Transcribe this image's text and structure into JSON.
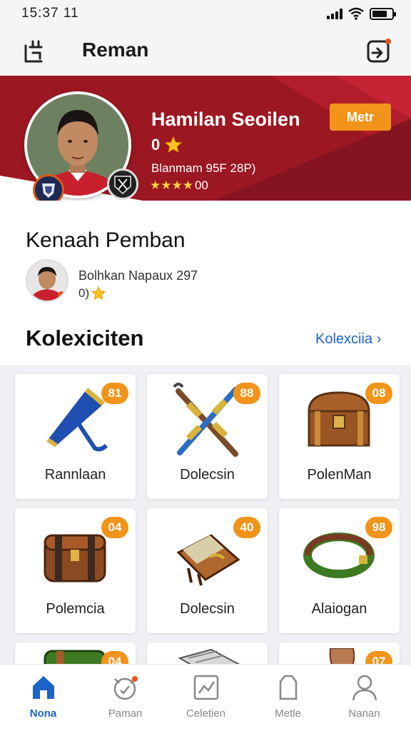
{
  "status_bar": {
    "time": "15:37 11"
  },
  "header": {
    "title": "Reman"
  },
  "profile": {
    "name": "Hamilan Seoilen",
    "level": "0",
    "meta": "Blanmam 95F 28P)",
    "rating_stars": "★★★★",
    "rating_value": "00",
    "more_label": "Metr"
  },
  "recommend": {
    "title": "Kenaah Pemban",
    "name": "Bolhkan Napaux 297",
    "level": "0)"
  },
  "collection": {
    "title": "Kolexiciten",
    "link": "Kolexciia ›",
    "items": [
      {
        "label": "Rannlaan",
        "count": "81"
      },
      {
        "label": "Dolecsin",
        "count": "88"
      },
      {
        "label": "PolenMan",
        "count": "08"
      },
      {
        "label": "Polemcia",
        "count": "04"
      },
      {
        "label": "Dolecsin",
        "count": "40"
      },
      {
        "label": "Alaiogan",
        "count": "98"
      },
      {
        "label": "",
        "count": "04"
      },
      {
        "label": "",
        "count": ""
      },
      {
        "label": "",
        "count": "07"
      }
    ]
  },
  "nav": [
    {
      "label": "Nona",
      "icon": "home-icon",
      "active": true
    },
    {
      "label": "Paman",
      "icon": "clock-icon",
      "active": false
    },
    {
      "label": "Celetien",
      "icon": "chart-icon",
      "active": false
    },
    {
      "label": "Metle",
      "icon": "bag-icon",
      "active": false
    },
    {
      "label": "Nanan",
      "icon": "user-icon",
      "active": false
    }
  ],
  "colors": {
    "banner": "#9b1722",
    "accent": "#f2941a",
    "link": "#1c64c8"
  }
}
